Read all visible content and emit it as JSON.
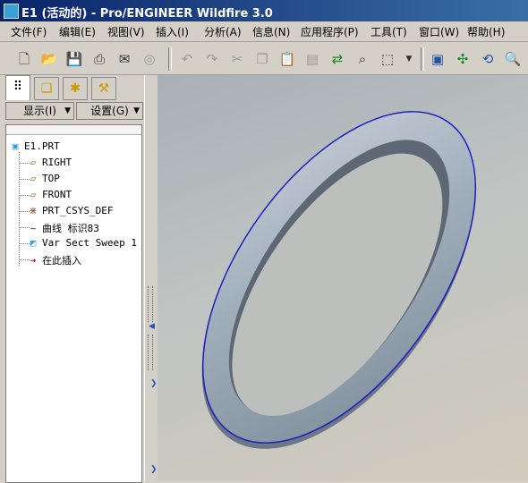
{
  "window": {
    "title": "E1 (活动的) - Pro/ENGINEER Wildfire 3.0",
    "icon": "proe-app-icon"
  },
  "menu": [
    "文件(F)",
    "编辑(E)",
    "视图(V)",
    "插入(I)",
    "分析(A)",
    "信息(N)",
    "应用程序(P)",
    "工具(T)",
    "窗口(W)",
    "帮助(H)"
  ],
  "toolbar": {
    "icons": [
      "new-file-icon",
      "open-folder-icon",
      "save-icon",
      "print-icon",
      "send-mail-icon",
      "mapkey-icon",
      "undo-icon",
      "redo-icon",
      "cut-icon",
      "copy-icon",
      "paste-icon",
      "paste-special-icon",
      "regenerate-icon",
      "find-icon",
      "selection-box-icon",
      "repaint-icon",
      "spin-center-icon",
      "orient-mode-icon",
      "zoom-in-icon"
    ]
  },
  "sidebar": {
    "tabs": [
      "model-tree-icon",
      "layers-icon",
      "favorites-icon",
      "connections-icon"
    ],
    "show_label": "显示(I)",
    "settings_label": "设置(G)"
  },
  "tree": {
    "root": "E1.PRT",
    "items": [
      {
        "label": "RIGHT",
        "icon": "datum-plane-icon"
      },
      {
        "label": "TOP",
        "icon": "datum-plane-icon"
      },
      {
        "label": "FRONT",
        "icon": "datum-plane-icon"
      },
      {
        "label": "PRT_CSYS_DEF",
        "icon": "coordinate-system-icon"
      },
      {
        "label": "曲线 标识83",
        "icon": "curve-icon"
      },
      {
        "label": "Var Sect Sweep 1",
        "icon": "sweep-feature-icon"
      },
      {
        "label": "在此插入",
        "icon": "insert-here-arrow-icon"
      }
    ]
  },
  "colors": {
    "title_bar": "#0a246a",
    "model": "#8e9eae",
    "edge_highlight": "#2020c0"
  }
}
